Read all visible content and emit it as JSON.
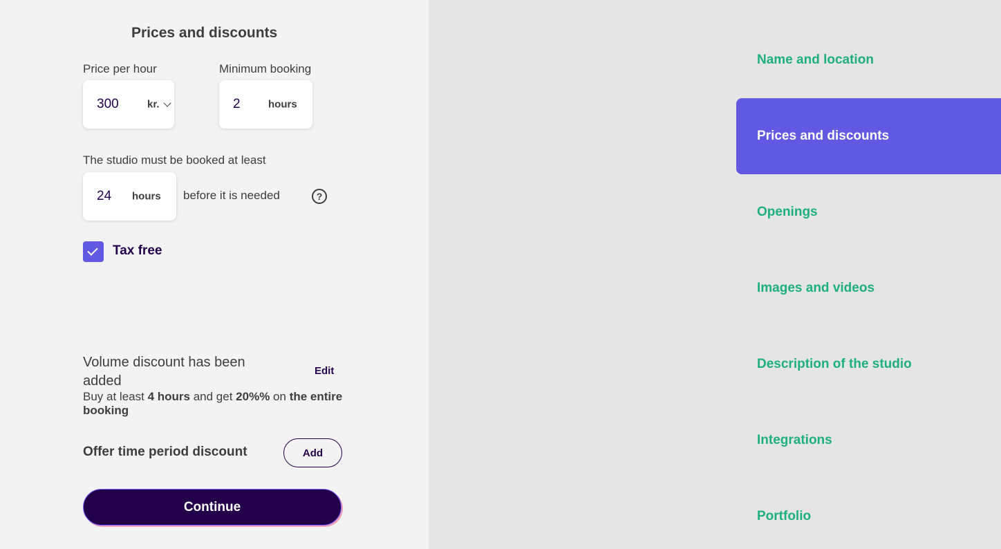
{
  "form": {
    "title": "Prices and discounts",
    "price_per_hour": {
      "label": "Price per hour",
      "value": "300",
      "currency": "kr."
    },
    "minimum_booking": {
      "label": "Minimum booking",
      "value": "2",
      "unit": "hours"
    },
    "advance_booking": {
      "label": "The studio must be booked at least",
      "value": "24",
      "unit": "hours",
      "suffix": "before it is needed",
      "help_symbol": "?"
    },
    "tax_free": {
      "label": "Tax free",
      "checked": true
    },
    "volume_discount": {
      "title": "Volume discount has been added",
      "edit_label": "Edit",
      "desc_prefix": "Buy at least",
      "desc_hours": "4 hours",
      "desc_mid": "and get",
      "desc_percent": "20%%",
      "desc_on": "on",
      "desc_scope": "the entire booking"
    },
    "time_period_discount": {
      "label": "Offer time period discount",
      "add_label": "Add"
    },
    "continue_label": "Continue"
  },
  "sidebar": {
    "items": [
      {
        "label": "Name and location",
        "active": false
      },
      {
        "label": "Prices and discounts",
        "active": true
      },
      {
        "label": "Openings",
        "active": false
      },
      {
        "label": "Images and videos",
        "active": false
      },
      {
        "label": "Description of the studio",
        "active": false
      },
      {
        "label": "Integrations",
        "active": false
      },
      {
        "label": "Portfolio",
        "active": false
      }
    ]
  },
  "colors": {
    "accent": "#6159e1",
    "nav_text": "#1db07c",
    "primary_dark": "#22004a",
    "left_bg": "#f3f3f3",
    "right_bg": "#e5e5e5"
  }
}
